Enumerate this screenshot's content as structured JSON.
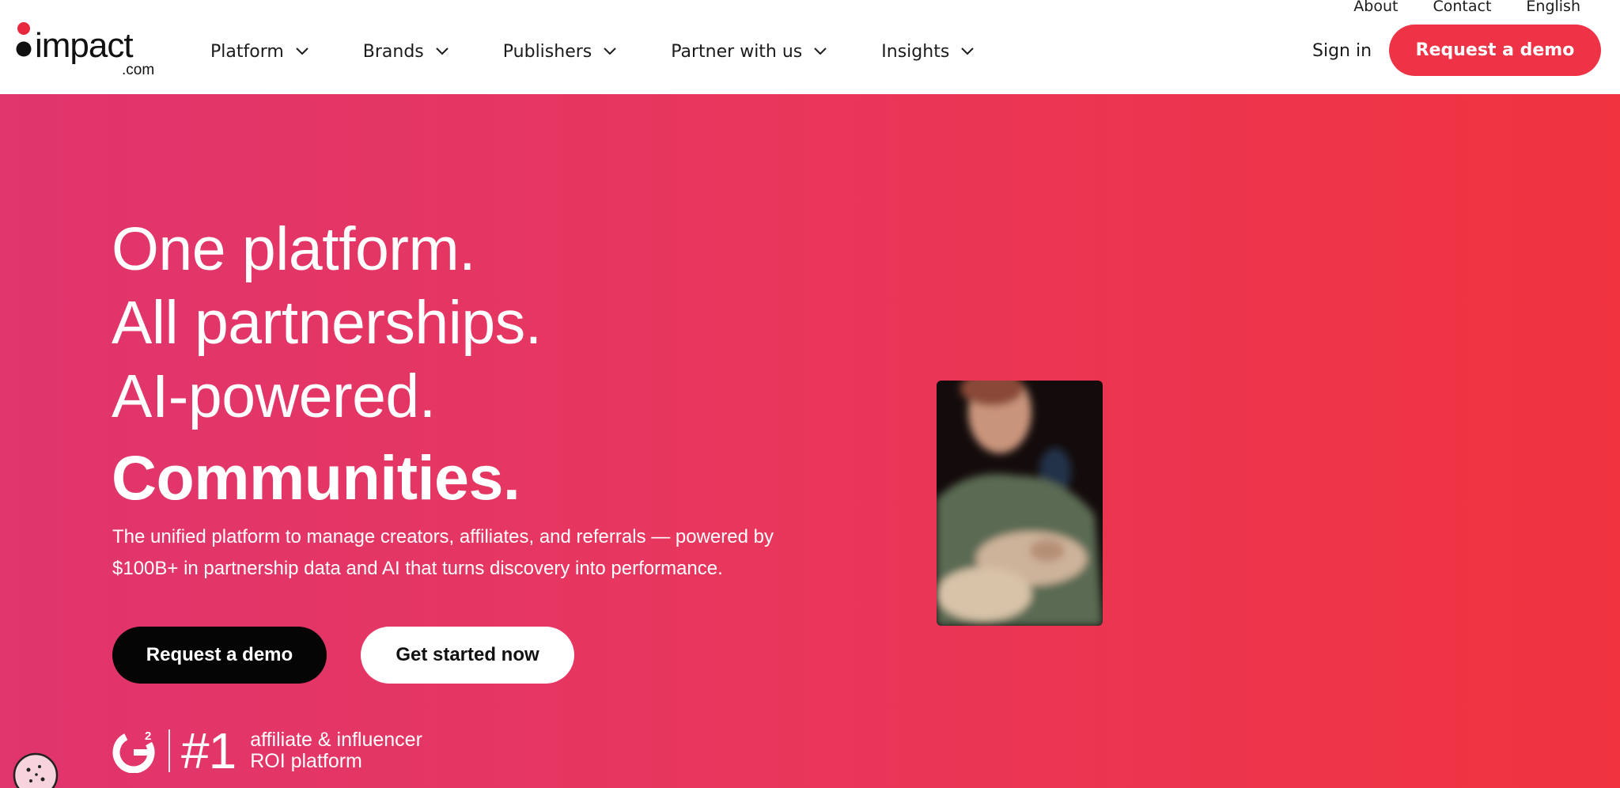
{
  "brand": {
    "name": "impact",
    "domain": ".com",
    "accent": "#ef3346",
    "dot_color": "#e8283e"
  },
  "utility_nav": [
    {
      "label": "About"
    },
    {
      "label": "Contact"
    },
    {
      "label": "English"
    }
  ],
  "main_nav": [
    {
      "label": "Platform",
      "icon": "chevron-down-icon"
    },
    {
      "label": "Brands",
      "icon": "chevron-down-icon"
    },
    {
      "label": "Publishers",
      "icon": "chevron-down-icon"
    },
    {
      "label": "Partner with us",
      "icon": "chevron-down-icon"
    },
    {
      "label": "Insights",
      "icon": "chevron-down-icon"
    }
  ],
  "header_actions": {
    "sign_in": "Sign in",
    "request_demo": "Request a demo"
  },
  "hero": {
    "headline_lines": [
      "One platform.",
      "All partnerships.",
      "AI-powered."
    ],
    "rotating_word": "Communities.",
    "subtext": "The unified platform to manage creators, affiliates, and referrals — powered by $100B+ in partnership data and AI that turns discovery into performance.",
    "primary_cta": "Request a demo",
    "secondary_cta": "Get started now",
    "gradient": [
      "#e0356d",
      "#f0333f"
    ],
    "award": {
      "logo_text": "G",
      "logo_superscript": "2",
      "rank": "#1",
      "line1": "affiliate & influencer",
      "line2": "ROI platform"
    }
  },
  "cookie_icon": "cookie-icon"
}
